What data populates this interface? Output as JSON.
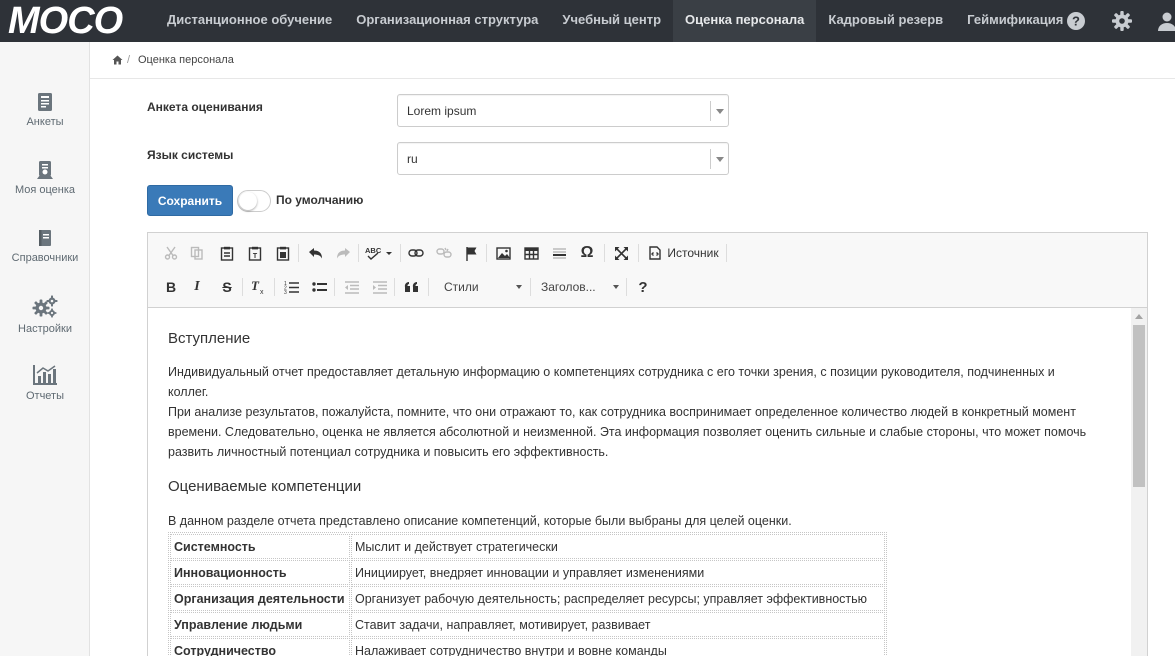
{
  "app": {
    "logo": "MOCO"
  },
  "nav": {
    "items": [
      {
        "label": "Дистанционное обучение",
        "active": false
      },
      {
        "label": "Организационная структура",
        "active": false
      },
      {
        "label": "Учебный центр",
        "active": false
      },
      {
        "label": "Оценка персонала",
        "active": true
      },
      {
        "label": "Кадровый резерв",
        "active": false
      },
      {
        "label": "Геймификация",
        "active": false
      }
    ],
    "icons": [
      "help-icon",
      "gear-icon",
      "user-icon"
    ]
  },
  "sidebar": {
    "items": [
      {
        "label": "Анкеты",
        "icon": "questionnaire-icon"
      },
      {
        "label": "Моя оценка",
        "icon": "my-assessment-icon"
      },
      {
        "label": "Справочники",
        "icon": "book-icon"
      },
      {
        "label": "Настройки",
        "icon": "gears-icon"
      },
      {
        "label": "Отчеты",
        "icon": "chart-icon"
      }
    ]
  },
  "breadcrumb": {
    "home_icon": "home-icon",
    "current": "Оценка персонала"
  },
  "form": {
    "questionnaire_label": "Анкета оценивания",
    "questionnaire_value": "Lorem ipsum",
    "language_label": "Язык системы",
    "language_value": "ru",
    "save_label": "Сохранить",
    "default_label": "По умолчанию",
    "default_on": false
  },
  "toolbar": {
    "source_label": "Источник",
    "styles_label": "Стили",
    "headings_label": "Заголов..."
  },
  "content": {
    "intro_heading": "Вступление",
    "intro_p1": "Индивидуальный отчет предоставляет детальную информацию о компетенциях сотрудника с его точки зрения, с позиции руководителя, подчиненных и коллег.",
    "intro_p2": "При анализе результатов, пожалуйста, помните, что они отражают то, как сотрудника воспринимает определенное количество людей в конкретный момент времени. Следовательно, оценка не является абсолютной и неизменной. Эта информация позволяет оценить сильные и слабые стороны, что может помочь развить личностный потенциал сотрудника и повысить его эффективность.",
    "competencies_heading": "Оцениваемые компетенции",
    "competencies_intro": "В данном разделе отчета представлено описание компетенций, которые были выбраны для целей оценки.",
    "competencies": [
      {
        "name": "Системность",
        "description": "Мыслит и действует стратегически"
      },
      {
        "name": "Инновационность",
        "description": "Инициирует, внедряет инновации и управляет изменениями"
      },
      {
        "name": "Организация деятельности",
        "description": "Организует рабочую деятельность; распределяет ресурсы; управляет эффективностью"
      },
      {
        "name": "Управление людьми",
        "description": "Ставит задачи, направляет, мотивирует, развивает"
      },
      {
        "name": "Сотрудничество",
        "description": "Налаживает сотрудничество внутри и вовне команды"
      }
    ]
  },
  "colors": {
    "topbar": "#2e3238",
    "primary_button": "#3a7ab8",
    "sidebar_bg": "#f6f6f6"
  }
}
